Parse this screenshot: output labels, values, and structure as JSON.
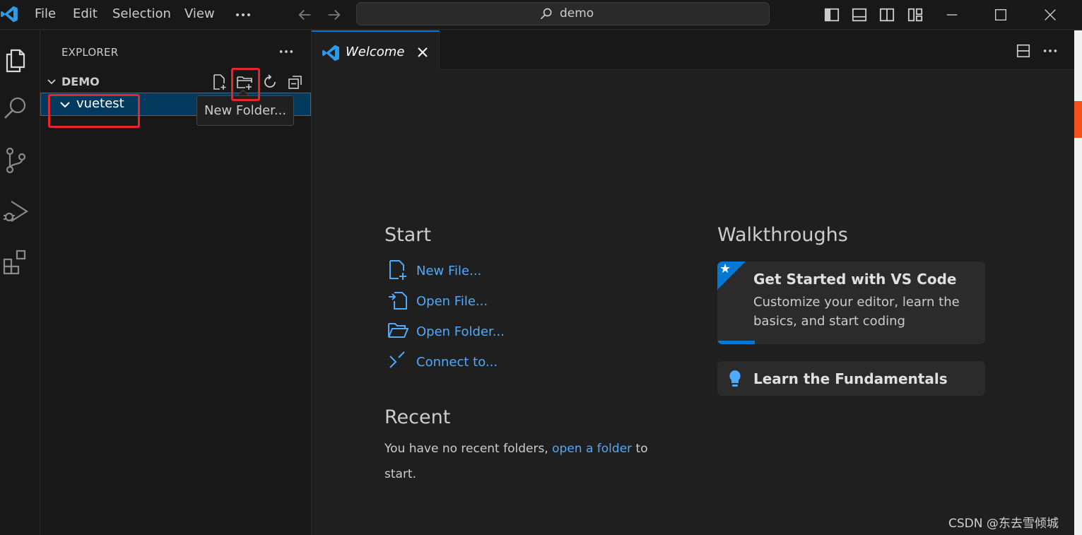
{
  "titlebar": {
    "menu": [
      "File",
      "Edit",
      "Selection",
      "View"
    ],
    "search_text": "demo"
  },
  "sidebar": {
    "title": "EXPLORER",
    "workspace": "DEMO",
    "folder": "vuetest",
    "tooltip": "New Folder..."
  },
  "tab": {
    "label": "Welcome"
  },
  "welcome": {
    "start_title": "Start",
    "start_links": [
      "New File...",
      "Open File...",
      "Open Folder...",
      "Connect to..."
    ],
    "recent_title": "Recent",
    "recent_prefix": "You have no recent folders,",
    "recent_link": "open a folder",
    "recent_suffix": "to start.",
    "walkthroughs_title": "Walkthroughs",
    "walkthrough_1": {
      "title": "Get Started with VS Code",
      "description": "Customize your editor, learn the basics, and start coding",
      "progress": 0.14
    },
    "walkthrough_2": {
      "title": "Learn the Fundamentals"
    }
  },
  "watermark": "CSDN @东去雪倾城",
  "colors": {
    "accent": "#0078d4",
    "link": "#4daafc",
    "highlight": "#e5262b"
  }
}
